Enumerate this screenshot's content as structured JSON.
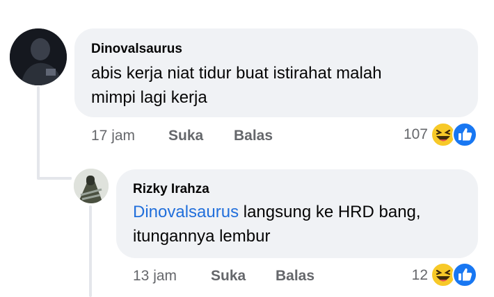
{
  "comment": {
    "author": "Dinovalsaurus",
    "text_line1": "abis kerja niat tidur buat istirahat malah",
    "text_line2": "mimpi lagi kerja",
    "time": "17 jam",
    "like_label": "Suka",
    "reply_label": "Balas",
    "reaction_count": "107",
    "reactions": [
      "haha-icon",
      "like-icon"
    ]
  },
  "reply": {
    "author": "Rizky Irahza",
    "mention": "Dinovalsaurus",
    "text_rest": " langsung ke HRD bang,",
    "text_line2": "itungannya lembur",
    "time": "13 jam",
    "like_label": "Suka",
    "reply_label": "Balas",
    "reaction_count": "12",
    "reactions": [
      "haha-icon",
      "like-icon"
    ]
  },
  "colors": {
    "bubble": "#f0f2f5",
    "meta_text": "#65676b",
    "mention": "#216fdb",
    "like_blue": "#1877f2",
    "haha_yellow": "#f7c928"
  }
}
